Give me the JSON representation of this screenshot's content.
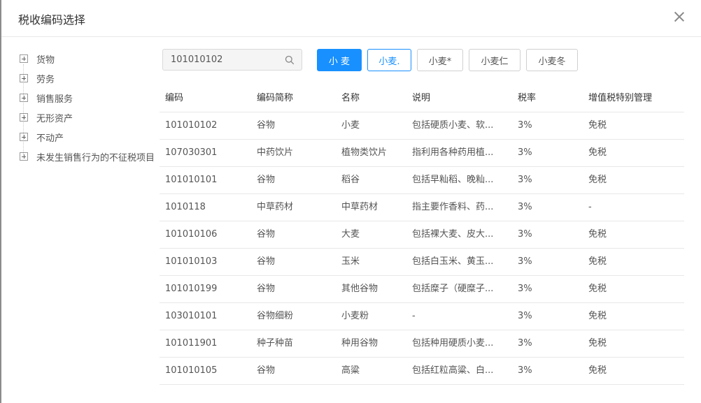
{
  "dialog": {
    "title": "税收编码选择"
  },
  "tree": {
    "items": [
      {
        "label": "货物"
      },
      {
        "label": "劳务"
      },
      {
        "label": "销售服务"
      },
      {
        "label": "无形资产"
      },
      {
        "label": "不动产"
      },
      {
        "label": "未发生销售行为的不征税项目"
      }
    ]
  },
  "search": {
    "value": "101010102"
  },
  "suggestions": [
    "小 麦",
    "小麦.",
    "小麦*",
    "小麦仁",
    "小麦冬"
  ],
  "table": {
    "columns": [
      "编码",
      "编码简称",
      "名称",
      "说明",
      "税率",
      "增值税特别管理"
    ],
    "rows": [
      [
        "101010102",
        "谷物",
        "小麦",
        "包括硬质小麦、软...",
        "3%",
        "免税"
      ],
      [
        "107030301",
        "中药饮片",
        "植物类饮片",
        "指利用各种药用植...",
        "3%",
        "免税"
      ],
      [
        "101010101",
        "谷物",
        "稻谷",
        "包括早籼稻、晚籼...",
        "3%",
        "免税"
      ],
      [
        "1010118",
        "中草药材",
        "中草药材",
        "指主要作香料、药...",
        "3%",
        "-"
      ],
      [
        "101010106",
        "谷物",
        "大麦",
        "包括裸大麦、皮大...",
        "3%",
        "免税"
      ],
      [
        "101010103",
        "谷物",
        "玉米",
        "包括白玉米、黄玉...",
        "3%",
        "免税"
      ],
      [
        "101010199",
        "谷物",
        "其他谷物",
        "包括糜子（硬糜子...",
        "3%",
        "免税"
      ],
      [
        "103010101",
        "谷物细粉",
        "小麦粉",
        "-",
        "3%",
        "免税"
      ],
      [
        "101011901",
        "种子种苗",
        "种用谷物",
        "包括种用硬质小麦...",
        "3%",
        "免税"
      ],
      [
        "101010105",
        "谷物",
        "高粱",
        "包括红粒高粱、白...",
        "3%",
        "免税"
      ]
    ]
  },
  "colors": {
    "primary": "#1890ff",
    "border": "#e8e8e8",
    "text": "#555555"
  }
}
